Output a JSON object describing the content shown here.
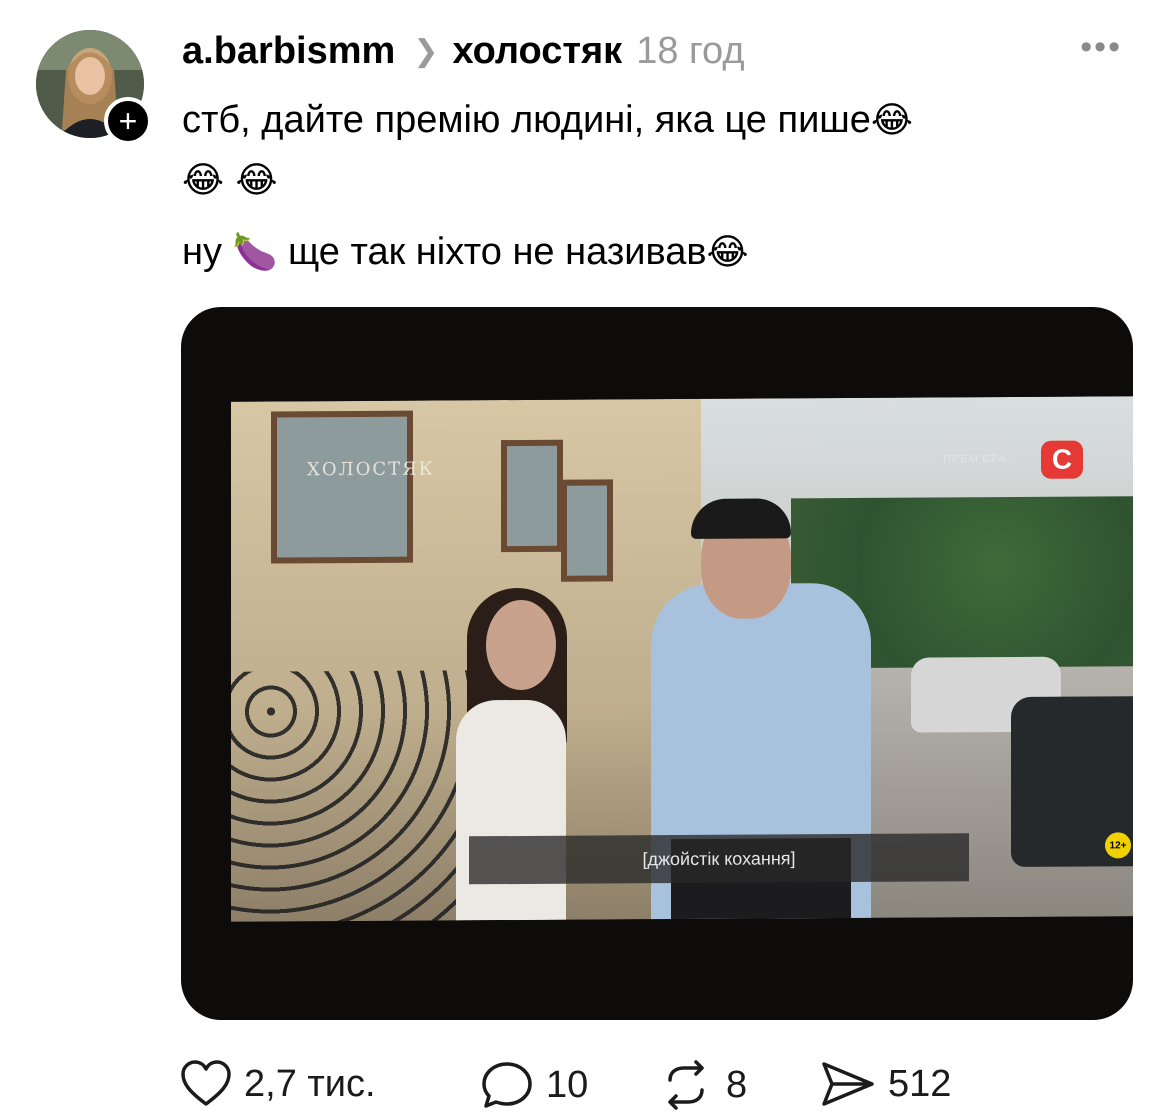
{
  "post": {
    "author": "a.barbismm",
    "topic": "холостяк",
    "time": "18 год",
    "more_label": "•••",
    "follow_label": "+",
    "text_lines": [
      {
        "text": "стб, дайте премію людині, яка це пише",
        "emoji_after": "😂"
      },
      {
        "emoji": "😂 😂"
      },
      {
        "before": "ну",
        "emoji": "🍆",
        "after": "ще так ніхто не називав",
        "emoji_after": "😂"
      }
    ]
  },
  "media": {
    "show_logo": "ХОЛОСТЯК",
    "premiere_label": "ПРЕМ'ЄРА",
    "channel_logo": "С",
    "age_rating": "12+",
    "subtitle": "[джойстік кохання]"
  },
  "actions": {
    "likes": "2,7 тис.",
    "replies": "10",
    "reposts": "8",
    "shares": "512"
  },
  "colors": {
    "text": "#000000",
    "muted": "#9a9a9a",
    "channel_red": "#e53935"
  }
}
